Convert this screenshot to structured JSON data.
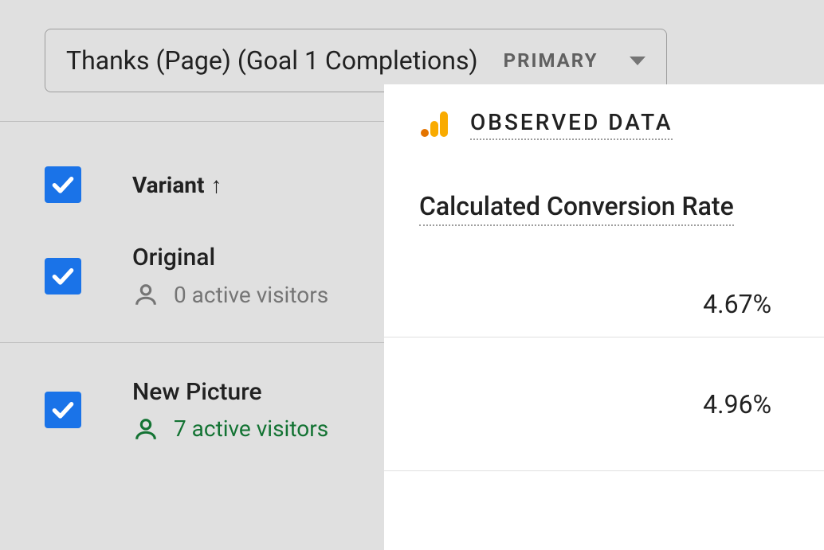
{
  "header": {
    "goal_text": "Thanks (Page) (Goal 1 Completions)",
    "primary_label": "PRIMARY"
  },
  "table": {
    "variant_header": "Variant",
    "sort_arrow": "↑",
    "rows": [
      {
        "name": "Original",
        "visitors": "0 active visitors",
        "status": "gray"
      },
      {
        "name": "New Picture",
        "visitors": "7 active visitors",
        "status": "green"
      }
    ]
  },
  "overlay": {
    "observed_label": "OBSERVED DATA",
    "section_title": "Calculated Conversion Rate",
    "values": [
      "4.67%",
      "4.96%"
    ]
  }
}
